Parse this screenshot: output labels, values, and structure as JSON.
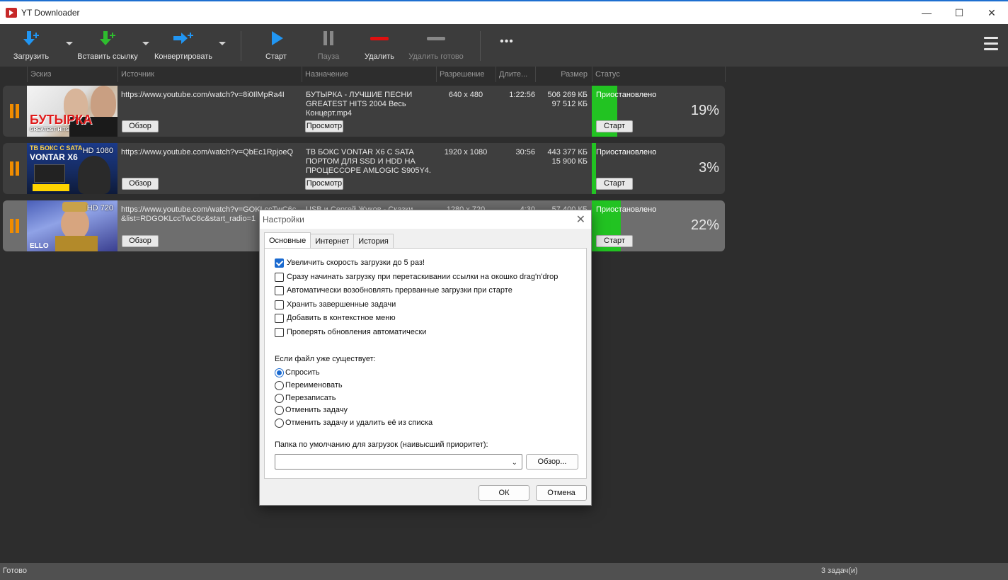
{
  "window": {
    "title": "YT Downloader",
    "minimize": "—",
    "maximize": "☐",
    "close": "✕"
  },
  "toolbar": {
    "download": "Загрузить",
    "paste_link": "Вставить ссылку",
    "convert": "Конвертировать",
    "start": "Старт",
    "pause": "Пауза",
    "delete": "Удалить",
    "delete_done": "Удалить готово",
    "more": "•••"
  },
  "columns": {
    "thumb": "Эскиз",
    "source": "Источник",
    "dest": "Назначение",
    "resolution": "Разрешение",
    "duration": "Длите...",
    "size": "Размер",
    "status": "Статус"
  },
  "rows": [
    {
      "thumb_badge": "",
      "thumb_title": "БУТЫРКА",
      "thumb_caption": "GREATEST HITS",
      "source": "https://www.youtube.com/watch?v=8i0IlMpRa4I",
      "source_line2": "",
      "browse": "Обзор",
      "dest_line1": "БУТЫРКА - ЛУЧШИЕ ПЕСНИ",
      "dest_line2": "GREATEST HITS  2004 Весь",
      "dest_line3": "Концерт.mp4",
      "preview": "Просмотр",
      "resolution": "640 x 480",
      "duration": "1:22:56",
      "size_total": "506 269 КБ",
      "size_done": "97 512 КБ",
      "status": "Приостановлено",
      "start": "Старт",
      "percent_label": "19%",
      "progress": 0.19
    },
    {
      "thumb_badge": "HD 1080",
      "thumb_title": "ТВ БОКС С SATA",
      "thumb_caption": "VONTAR X6",
      "source": "https://www.youtube.com/watch?v=QbEc1RpjoeQ",
      "source_line2": "",
      "browse": "Обзор",
      "dest_line1": "ТВ БОКС VONTAR X6 С SATA",
      "dest_line2": "ПОРТОМ ДЛЯ SSD И HDD НА",
      "dest_line3": "ПРОЦЕССОРЕ AMLOGIC S905Y4. ...",
      "preview": "Просмотр",
      "resolution": "1920 x 1080",
      "duration": "30:56",
      "size_total": "443 377 КБ",
      "size_done": "15 900 КБ",
      "status": "Приостановлено",
      "start": "Старт",
      "percent_label": "3%",
      "progress": 0.03
    },
    {
      "thumb_badge": "HD 720",
      "thumb_title": "",
      "thumb_caption": "ELLO",
      "source": "https://www.youtube.com/watch?v=GOKLccTwC6c",
      "source_line2": "&list=RDGOKLccTwC6c&start_radio=1",
      "browse": "Обзор",
      "dest_line1": "USB и Сергей Жуков - Сказки",
      "dest_line2": "",
      "dest_line3": "",
      "preview": "",
      "resolution": "1280 x 720",
      "duration": "4:30",
      "size_total": "57 400 КБ",
      "size_done": "",
      "status": "Приостановлено",
      "start": "Старт",
      "percent_label": "22%",
      "progress": 0.22
    }
  ],
  "statusbar": {
    "left": "Готово",
    "right": "3 задач(и)"
  },
  "dialog": {
    "title": "Настройки",
    "close": "✕",
    "tabs": [
      "Основные",
      "Интернет",
      "История"
    ],
    "checkboxes": [
      {
        "label": "Увеличить скорость загрузки до 5 раз!",
        "checked": true
      },
      {
        "label": "Сразу начинать загрузку при перетаскивании ссылки на окошко drag'n'drop",
        "checked": false
      },
      {
        "label": "Автоматически возобновлять прерванные загрузки при старте",
        "checked": false
      },
      {
        "label": "Хранить завершенные задачи",
        "checked": false
      },
      {
        "label": "Добавить в контекстное меню",
        "checked": false
      },
      {
        "label": "Проверять обновления автоматически",
        "checked": false
      }
    ],
    "exists_label": "Если файл уже существует:",
    "radios": [
      {
        "label": "Спросить",
        "checked": true
      },
      {
        "label": "Переименовать",
        "checked": false
      },
      {
        "label": "Перезаписать",
        "checked": false
      },
      {
        "label": "Отменить задачу",
        "checked": false
      },
      {
        "label": "Отменить задачу и удалить её из списка",
        "checked": false
      }
    ],
    "folder_label": "Папка по умолчанию для загрузок (наивысший приоритет):",
    "folder_value": "",
    "browse": "Обзор...",
    "ok": "ОК",
    "cancel": "Отмена"
  },
  "colors": {
    "accent": "#1a6ad0",
    "progress_green": "#22c322",
    "pause_orange": "#f08c00",
    "delete_red": "#e01010"
  }
}
